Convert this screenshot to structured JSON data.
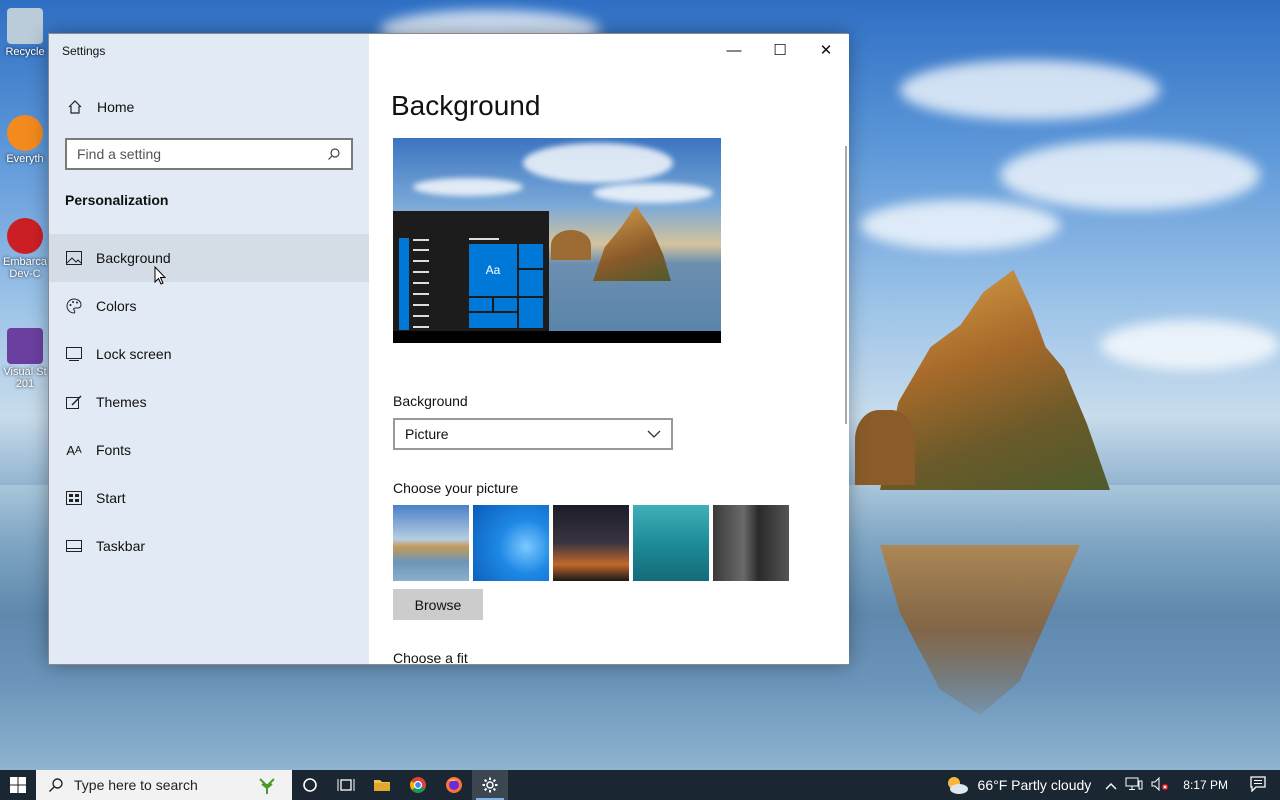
{
  "desktop": {
    "icons": [
      {
        "label": "Recycle",
        "color": "#9fb8c8"
      },
      {
        "label": "Everyth",
        "color": "#f28a1e"
      },
      {
        "label": "Embarca Dev-C",
        "color": "#cc1f25"
      },
      {
        "label": "Visual St 201",
        "color": "#6b3fa0"
      }
    ]
  },
  "window": {
    "title": "Settings",
    "caption": {
      "minimize": "—",
      "maximize": "☐",
      "close": "✕"
    },
    "sidebar": {
      "home": "Home",
      "search_placeholder": "Find a setting",
      "section": "Personalization",
      "items": [
        {
          "label": "Background",
          "icon": "image-icon",
          "active": true
        },
        {
          "label": "Colors",
          "icon": "palette-icon"
        },
        {
          "label": "Lock screen",
          "icon": "lock-screen-icon"
        },
        {
          "label": "Themes",
          "icon": "themes-icon"
        },
        {
          "label": "Fonts",
          "icon": "fonts-icon"
        },
        {
          "label": "Start",
          "icon": "start-icon"
        },
        {
          "label": "Taskbar",
          "icon": "taskbar-icon"
        }
      ]
    },
    "main": {
      "title": "Background",
      "preview_tile": "Aa",
      "background_label": "Background",
      "background_value": "Picture",
      "choose_picture_label": "Choose your picture",
      "browse_label": "Browse",
      "choose_fit_label": "Choose a fit"
    }
  },
  "taskbar": {
    "search_placeholder": "Type here to search",
    "weather": "66°F  Partly cloudy",
    "time": "8:17 PM"
  }
}
